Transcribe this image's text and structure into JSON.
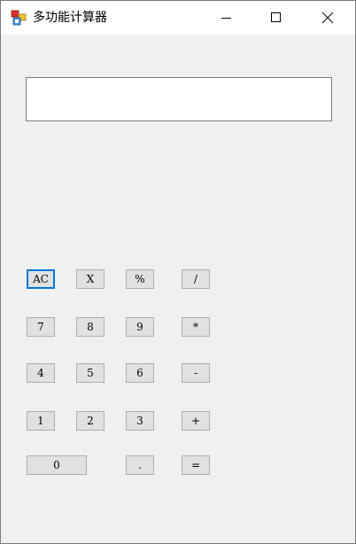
{
  "window": {
    "title": "多功能计算器"
  },
  "titlebar_buttons": {
    "minimize": "minimize-icon",
    "maximize": "maximize-icon",
    "close": "close-icon"
  },
  "display": {
    "value": ""
  },
  "keys": {
    "ac": "AC",
    "x": "X",
    "percent": "%",
    "divide": "/",
    "seven": "7",
    "eight": "8",
    "nine": "9",
    "multiply": "*",
    "four": "4",
    "five": "5",
    "six": "6",
    "minus": "-",
    "one": "1",
    "two": "2",
    "three": "3",
    "plus": "+",
    "zero": "0",
    "dot": ".",
    "equals": "="
  },
  "colors": {
    "window_bg": "#f0f0f0",
    "titlebar_bg": "#ffffff",
    "key_bg": "#e1e1e1",
    "key_border": "#adadad",
    "focus_border": "#0078d7"
  }
}
